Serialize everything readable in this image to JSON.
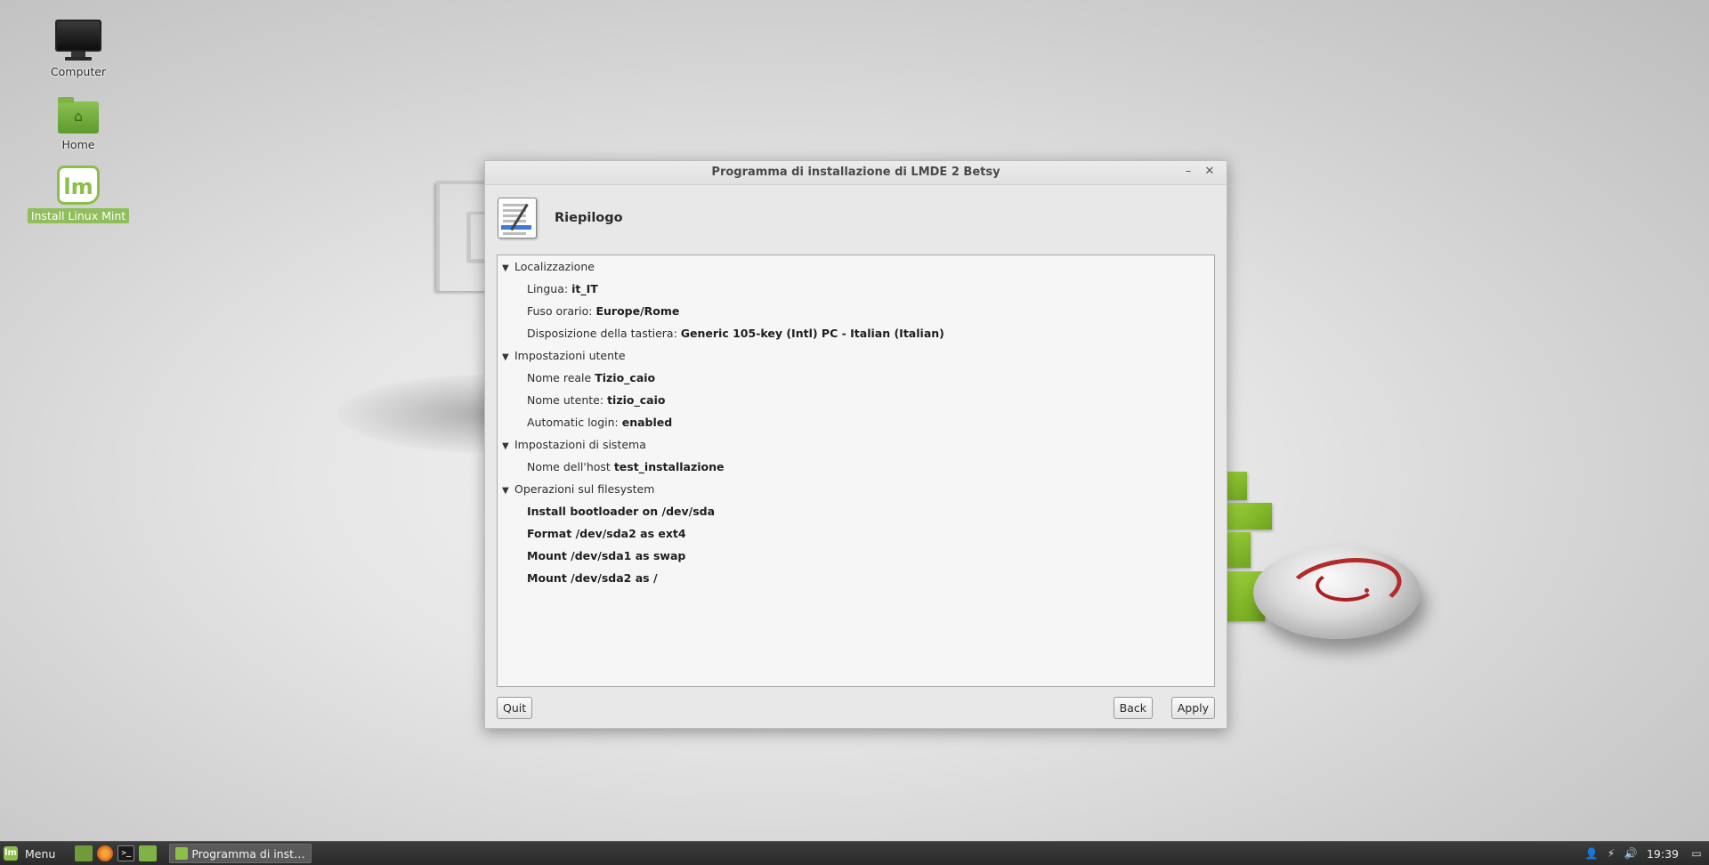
{
  "desktop": {
    "icons": [
      {
        "label": "Computer",
        "icon": "monitor-icon"
      },
      {
        "label": "Home",
        "icon": "home-folder-icon"
      },
      {
        "label": "Install Linux Mint",
        "icon": "linux-mint-logo-icon",
        "selected": true
      }
    ]
  },
  "window": {
    "title": "Programma di installazione di LMDE 2 Betsy",
    "minimize_glyph": "–",
    "close_glyph": "✕",
    "page_title": "Riepilogo",
    "sections": [
      {
        "title": "Localizzazione",
        "items": [
          {
            "label": "Lingua: ",
            "value": "it_IT"
          },
          {
            "label": "Fuso orario: ",
            "value": "Europe/Rome"
          },
          {
            "label": "Disposizione della tastiera: ",
            "value": "Generic 105-key (Intl) PC - Italian (Italian)"
          }
        ]
      },
      {
        "title": "Impostazioni utente",
        "items": [
          {
            "label": "Nome reale ",
            "value": "Tizio_caio"
          },
          {
            "label": "Nome utente: ",
            "value": "tizio_caio"
          },
          {
            "label": "Automatic login: ",
            "value": "enabled"
          }
        ]
      },
      {
        "title": "Impostazioni di sistema",
        "items": [
          {
            "label": "Nome dell'host ",
            "value": "test_installazione"
          }
        ]
      },
      {
        "title": "Operazioni sul filesystem",
        "items": [
          {
            "label": "",
            "value": "Install bootloader on /dev/sda"
          },
          {
            "label": "",
            "value": "Format /dev/sda2 as ext4"
          },
          {
            "label": "",
            "value": "Mount /dev/sda1 as swap"
          },
          {
            "label": "",
            "value": "Mount /dev/sda2 as /"
          }
        ]
      }
    ],
    "buttons": {
      "quit": "Quit",
      "back": "Back",
      "apply": "Apply"
    }
  },
  "taskbar": {
    "menu_label": "Menu",
    "launchers": [
      "show-desktop-icon",
      "firefox-icon",
      "terminal-icon",
      "files-icon"
    ],
    "terminal_glyph": ">_",
    "window_button": "Programma di install...",
    "tray": [
      "user-icon",
      "network-icon",
      "volume-icon"
    ],
    "clock": "19:39",
    "colors": {
      "accent": "#8bbf4a",
      "panel": "#2b2b2b"
    }
  }
}
